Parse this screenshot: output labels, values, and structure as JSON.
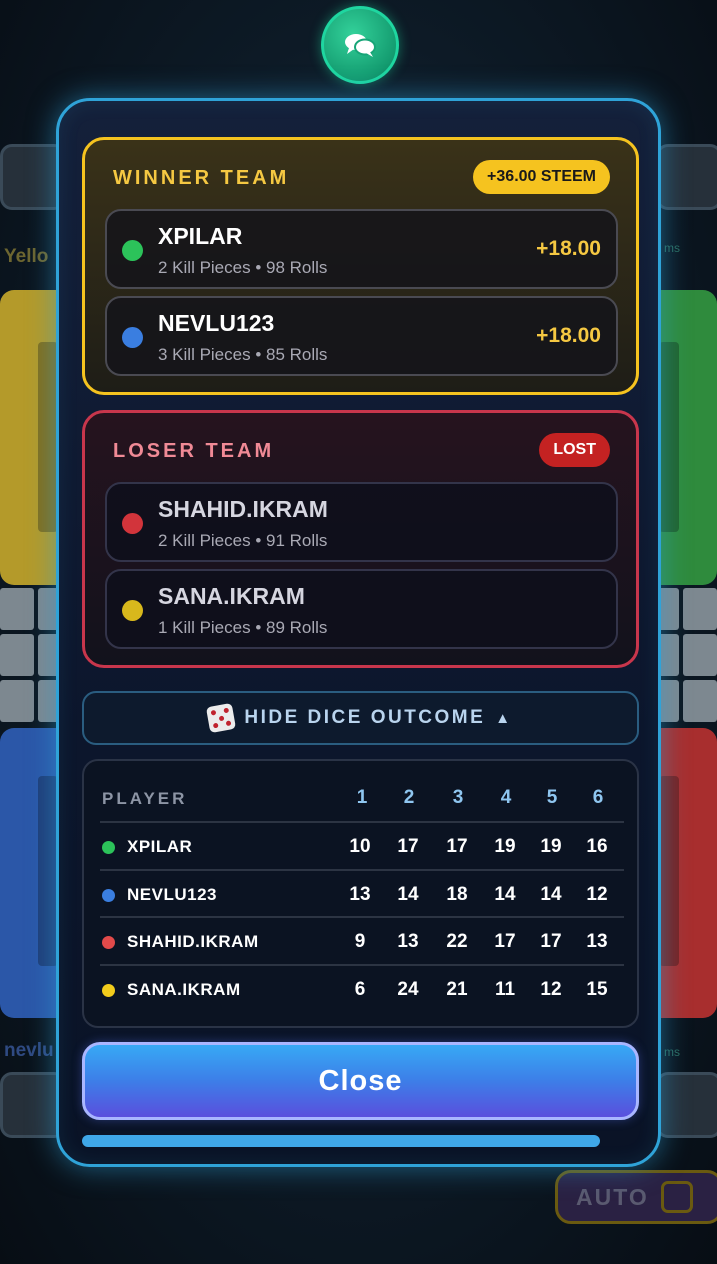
{
  "background": {
    "top_left_label": "Yello",
    "bottom_left_label": "nevlu",
    "right_snippet": "ms",
    "auto_label": "AUTO"
  },
  "chat": {
    "icon": "chat-bubbles-icon"
  },
  "winner_team": {
    "title": "WINNER TEAM",
    "badge": "+36.00 STEEM",
    "accent_color": "#f5c31f",
    "players": [
      {
        "name": "XPILAR",
        "stats": "2 Kill Pieces • 98 Rolls",
        "score": "+18.00",
        "color": "#2cc35a"
      },
      {
        "name": "NEVLU123",
        "stats": "3 Kill Pieces • 85 Rolls",
        "score": "+18.00",
        "color": "#3a7ee0"
      }
    ]
  },
  "loser_team": {
    "title": "LOSER TEAM",
    "badge": "LOST",
    "accent_color": "#c8364c",
    "players": [
      {
        "name": "SHAHID.IKRAM",
        "stats": "2 Kill Pieces • 91 Rolls",
        "color": "#d2343b"
      },
      {
        "name": "SANA.IKRAM",
        "stats": "1 Kill Pieces • 89 Rolls",
        "color": "#d8b81c"
      }
    ]
  },
  "dice_toggle": {
    "label": "HIDE DICE OUTCOME",
    "arrow": "▲",
    "icon": "dice-icon"
  },
  "dice_table": {
    "header_player": "PLAYER",
    "columns": [
      "1",
      "2",
      "3",
      "4",
      "5",
      "6"
    ],
    "rows": [
      {
        "name": "XPILAR",
        "color": "#2cc35a",
        "values": [
          "10",
          "17",
          "17",
          "19",
          "19",
          "16"
        ]
      },
      {
        "name": "NEVLU123",
        "color": "#3a7ee0",
        "values": [
          "13",
          "14",
          "18",
          "14",
          "14",
          "12"
        ]
      },
      {
        "name": "SHAHID.IKRAM",
        "color": "#e24a4a",
        "values": [
          "9",
          "13",
          "22",
          "17",
          "17",
          "13"
        ]
      },
      {
        "name": "SANA.IKRAM",
        "color": "#f2cc1c",
        "values": [
          "6",
          "24",
          "21",
          "11",
          "12",
          "15"
        ]
      }
    ]
  },
  "close_button": {
    "label": "Close"
  },
  "progress": {
    "fraction": 0.93
  }
}
